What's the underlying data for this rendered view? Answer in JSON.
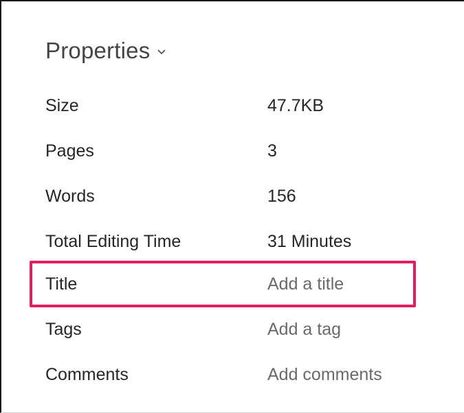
{
  "panel": {
    "title": "Properties",
    "chevron_icon": "chevron-down-icon"
  },
  "properties": [
    {
      "label": "Size",
      "value": "47.7KB"
    },
    {
      "label": "Pages",
      "value": "3"
    },
    {
      "label": "Words",
      "value": "156"
    },
    {
      "label": "Total Editing Time",
      "value": "31 Minutes"
    },
    {
      "label": "Title",
      "value": "Add a title"
    },
    {
      "label": "Tags",
      "value": "Add a tag"
    },
    {
      "label": "Comments",
      "value": "Add comments"
    }
  ],
  "colors": {
    "highlight": "#e0205e",
    "placeholder_text": "#6a6a6a",
    "label_text": "#262626"
  }
}
